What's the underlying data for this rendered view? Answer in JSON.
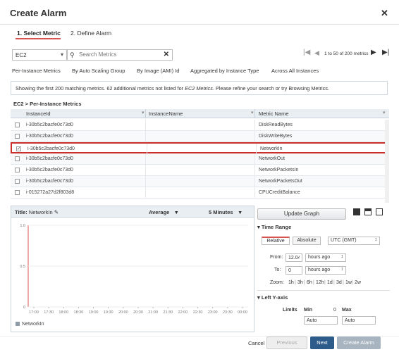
{
  "dialog": {
    "title": "Create Alarm"
  },
  "steps": [
    {
      "label": "1. Select Metric"
    },
    {
      "label": "2. Define Alarm"
    }
  ],
  "toolbar": {
    "namespace": "EC2",
    "search_placeholder": "Search Metrics",
    "pager_text": "1 to 50 of 200 metrics"
  },
  "category_tabs": [
    {
      "label": "Per-Instance Metrics"
    },
    {
      "label": "By Auto Scaling Group"
    },
    {
      "label": "By Image (AMI) Id"
    },
    {
      "label": "Aggregated by Instance Type"
    },
    {
      "label": "Across All Instances"
    }
  ],
  "info_bar": {
    "text_before": "Showing the first 200 matching metrics. 62 additional metrics not listed for ",
    "text_em": "EC2 Metrics",
    "text_after": ". Please refine your search or try Browsing Metrics."
  },
  "breadcrumb": "EC2 > Per-Instance Metrics",
  "table": {
    "columns": [
      {
        "label": "InstanceId"
      },
      {
        "label": "InstanceName"
      },
      {
        "label": "Metric Name"
      }
    ],
    "rows": [
      {
        "instance_id": "i-30b5c2bacfe0c73d0",
        "instance_name": "",
        "metric": "DiskReadBytes",
        "checked": false
      },
      {
        "instance_id": "i-30b5c2bacfe0c73d0",
        "instance_name": "",
        "metric": "DiskWriteBytes",
        "checked": false
      },
      {
        "instance_id": "i-30b5c2bacfe0c73d0",
        "instance_name": "",
        "metric": "NetworkIn",
        "checked": true
      },
      {
        "instance_id": "i-30b5c2bacfe0c73d0",
        "instance_name": "",
        "metric": "NetworkOut",
        "checked": false
      },
      {
        "instance_id": "i-30b5c2bacfe0c73d0",
        "instance_name": "",
        "metric": "NetworkPacketsIn",
        "checked": false
      },
      {
        "instance_id": "i-30b5c2bacfe0c73d0",
        "instance_name": "",
        "metric": "NetworkPacketsOut",
        "checked": false
      },
      {
        "instance_id": "i-015272a27d2f803d8",
        "instance_name": "",
        "metric": "CPUCreditBalance",
        "checked": false
      }
    ]
  },
  "graph": {
    "title_label": "Title:",
    "title_value": "NetworkIn",
    "statistic": "Average",
    "period": "5 Minutes",
    "legend": "NetworkIn"
  },
  "chart_data": {
    "type": "line",
    "title": "NetworkIn",
    "xlabel": "",
    "ylabel": "",
    "x": [
      "17:00",
      "17:30",
      "18:00",
      "18:30",
      "19:00",
      "19:30",
      "20:00",
      "20:30",
      "21:00",
      "21:30",
      "22:00",
      "22:30",
      "23:00",
      "23:30",
      "00:00"
    ],
    "yticks": [
      "1.0",
      "0.5",
      "0"
    ],
    "ylim": [
      0,
      1
    ],
    "series": [
      {
        "name": "NetworkIn",
        "values": []
      }
    ],
    "grid": true,
    "legend": "bottom-left"
  },
  "right_panel": {
    "update_graph": "Update Graph",
    "time_range_head": "Time Range",
    "relative": "Relative",
    "absolute": "Absolute",
    "timezone": "UTC (GMT)",
    "from_label": "From:",
    "from_value": "12.04",
    "from_unit": "hours ago",
    "to_label": "To:",
    "to_value": "0",
    "to_unit": "hours ago",
    "zoom_label": "Zoom:",
    "zoom_items": [
      "1h",
      "3h",
      "6h",
      "12h",
      "1d",
      "3d",
      "1w",
      "2w"
    ],
    "left_y_head": "Left Y-axis",
    "limits_label": "Limits",
    "min_label": "Min",
    "min_value": "0",
    "max_label": "Max",
    "min_input": "Auto",
    "max_input": "Auto"
  },
  "footer": {
    "cancel": "Cancel",
    "previous": "Previous",
    "next": "Next",
    "create_alarm": "Create Alarm"
  }
}
